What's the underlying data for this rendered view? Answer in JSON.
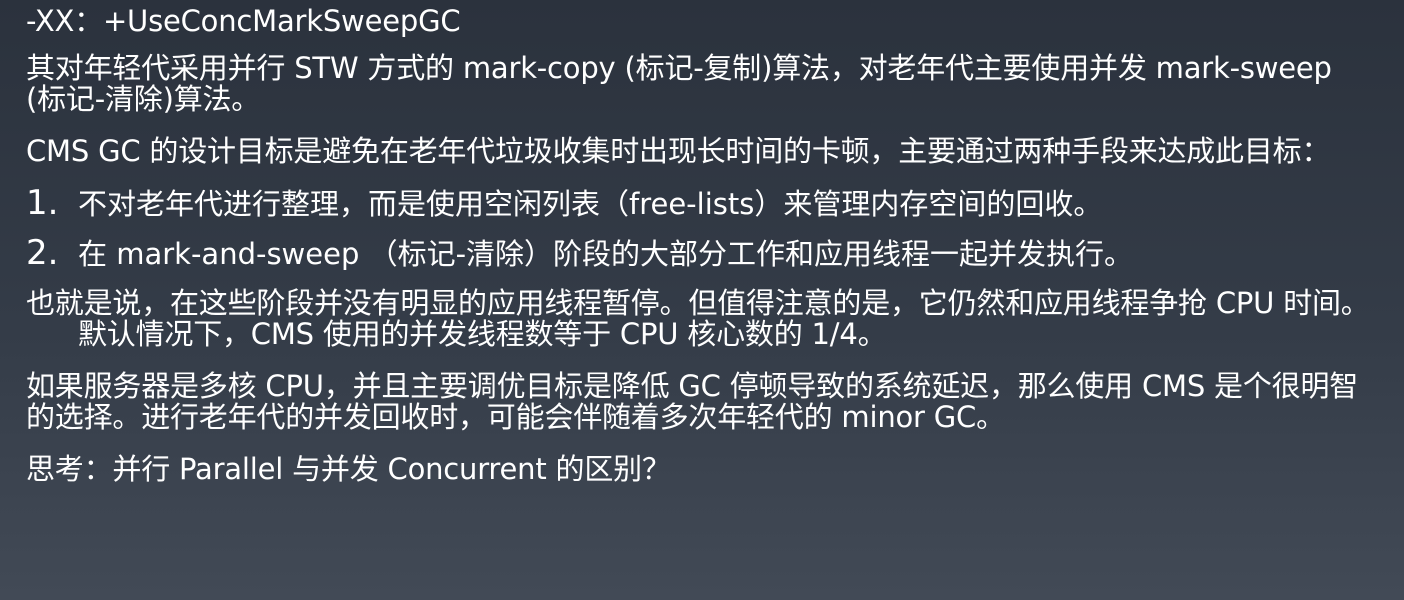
{
  "slide": {
    "heading": "-XX：+UseConcMarkSweepGC",
    "para1": "其对年轻代采用并行 STW 方式的 mark-copy (标记-复制)算法，对老年代主要使用并发 mark-sweep (标记-清除)算法。",
    "para2": "CMS GC 的设计目标是避免在老年代垃圾收集时出现长时间的卡顿，主要通过两种手段来达成此目标：",
    "items": [
      {
        "num": "1.",
        "text": "不对老年代进行整理，而是使用空闲列表（free-lists）来管理内存空间的回收。"
      },
      {
        "num": "2.",
        "text": "在 mark-and-sweep （标记-清除）阶段的大部分工作和应用线程一起并发执行。"
      }
    ],
    "para3": "也就是说，在这些阶段并没有明显的应用线程暂停。但值得注意的是，它仍然和应用线程争抢 CPU 时间。默认情况下，CMS 使用的并发线程数等于 CPU 核心数的 1/4。",
    "para4": "如果服务器是多核 CPU，并且主要调优目标是降低 GC 停顿导致的系统延迟，那么使用 CMS 是个很明智的选择。进行老年代的并发回收时，可能会伴随着多次年轻代的 minor GC。",
    "para5": "思考：并行 Parallel 与并发 Concurrent 的区别？"
  }
}
